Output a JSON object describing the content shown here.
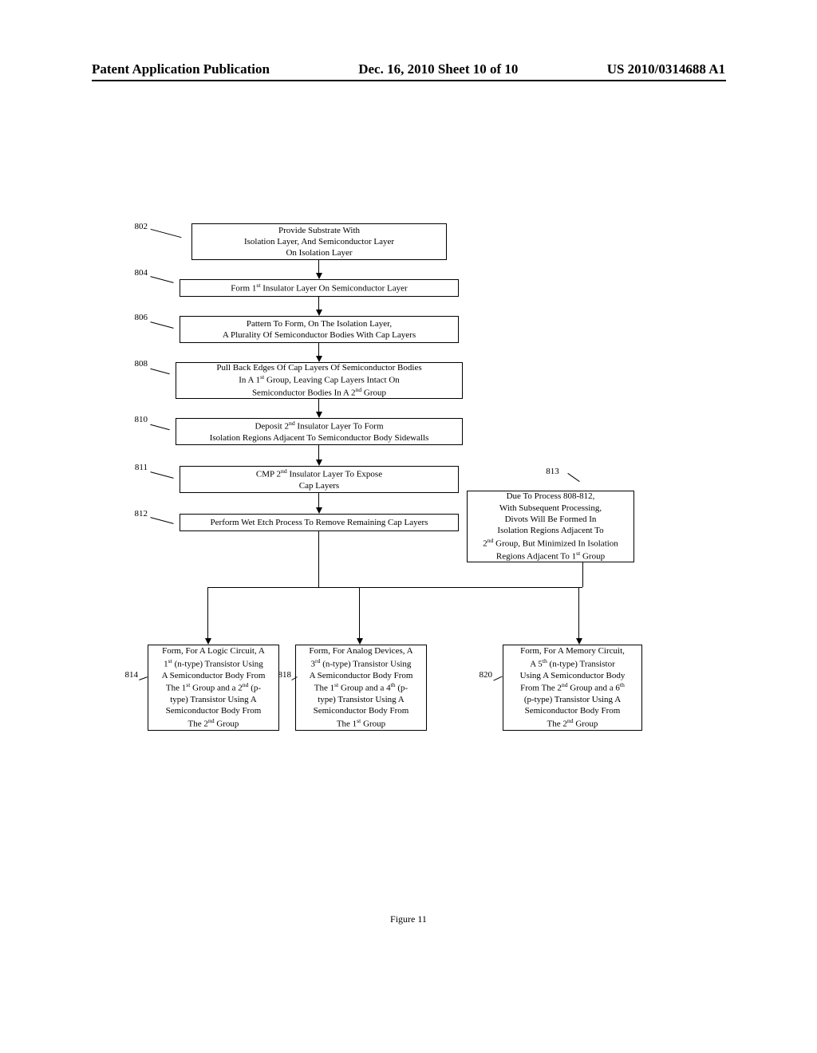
{
  "header": {
    "left": "Patent Application Publication",
    "center": "Dec. 16, 2010  Sheet 10 of 10",
    "right": "US 2010/0314688 A1"
  },
  "labels": {
    "l802": "802",
    "l804": "804",
    "l806": "806",
    "l808": "808",
    "l810": "810",
    "l811": "811",
    "l812": "812",
    "l813": "813",
    "l814": "814",
    "l818": "818",
    "l820": "820"
  },
  "boxes": {
    "b802": "Provide Substrate With\nIsolation Layer, And Semiconductor Layer\nOn Isolation Layer",
    "b804": "Form 1<sup>st</sup> Insulator Layer On Semiconductor Layer",
    "b806": "Pattern To Form, On The Isolation Layer,\nA Plurality Of Semiconductor Bodies With Cap Layers",
    "b808": "Pull Back Edges Of Cap Layers Of Semiconductor Bodies\nIn A 1<sup>st</sup> Group, Leaving Cap Layers Intact On\nSemiconductor Bodies In A 2<sup>nd</sup> Group",
    "b810": "Deposit 2<sup>nd</sup> Insulator Layer To Form\nIsolation Regions Adjacent To Semiconductor Body Sidewalls",
    "b811": "CMP 2<sup>nd</sup> Insulator Layer To Expose\nCap Layers",
    "b812": "Perform Wet Etch Process To Remove Remaining Cap Layers",
    "b813": "Due To Process 808-812,\nWith Subsequent Processing,\nDivots Will Be Formed In\nIsolation Regions Adjacent To\n2<sup>nd</sup> Group, But Minimized In Isolation\nRegions Adjacent To 1<sup>st</sup> Group",
    "b814": "Form, For A Logic Circuit, A\n1<sup>st</sup> (n-type) Transistor Using\nA Semiconductor Body From\nThe 1<sup>st</sup> Group and a 2<sup>nd</sup> (p-\ntype) Transistor Using A\nSemiconductor Body From\nThe 2<sup>nd</sup> Group",
    "b818": "Form, For Analog Devices, A\n3<sup>rd</sup> (n-type) Transistor Using\nA Semiconductor Body From\nThe 1<sup>st</sup> Group and a 4<sup>th</sup> (p-\ntype) Transistor Using A\nSemiconductor Body From\nThe 1<sup>st</sup> Group",
    "b820": "Form, For A Memory Circuit,\nA 5<sup>th</sup> (n-type) Transistor\nUsing A Semiconductor Body\nFrom The 2<sup>nd</sup> Group and a 6<sup>th</sup>\n(p-type) Transistor Using A\nSemiconductor Body From\nThe 2<sup>nd</sup> Group"
  },
  "figure_caption": "Figure 11"
}
